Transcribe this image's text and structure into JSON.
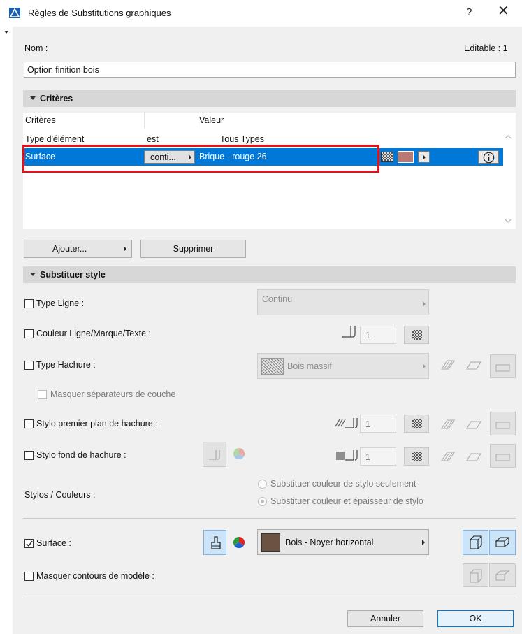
{
  "window": {
    "title": "Règles de Substitutions graphiques",
    "help": "?",
    "close": "✕"
  },
  "nom": {
    "label": "Nom :",
    "editable": "Editable : 1",
    "value": "Option finition bois"
  },
  "criteres": {
    "section_title": "Critères",
    "headers": [
      "Critères",
      "",
      "Valeur"
    ],
    "rows": [
      {
        "name": "Type d'élément",
        "op": "est",
        "value": "Tous Types"
      },
      {
        "name": "Surface",
        "op": "conti...",
        "value": "Brique - rouge 26"
      }
    ],
    "add_button": "Ajouter...",
    "delete_button": "Supprimer",
    "swatch_color": "#b87a72",
    "highlight_color": "#0078d7",
    "annotation_color": "#e0121c"
  },
  "substituer": {
    "section_title": "Substituer style",
    "type_ligne": {
      "label": "Type Ligne :",
      "value": "Continu"
    },
    "couleur": {
      "label": "Couleur Ligne/Marque/Texte :",
      "pen": "1"
    },
    "type_hachure": {
      "label": "Type Hachure :",
      "value": "Bois massif"
    },
    "masquer_sep": {
      "label": "Masquer séparateurs de couche"
    },
    "stylo_premier": {
      "label": "Stylo premier plan de hachure :",
      "pen": "1"
    },
    "stylo_fond": {
      "label": "Stylo fond de hachure :",
      "pen": "1"
    },
    "stylos": {
      "label": "Stylos / Couleurs :",
      "option1": "Substituer couleur de stylo seulement",
      "option2": "Substituer couleur et épaisseur de stylo"
    },
    "surface": {
      "label": "Surface :",
      "value": "Bois - Noyer horizontal",
      "checked": true,
      "swatch_color": "#6b5344"
    },
    "masquer_contours": {
      "label": "Masquer contours de modèle :"
    }
  },
  "footer": {
    "cancel": "Annuler",
    "ok": "OK"
  }
}
